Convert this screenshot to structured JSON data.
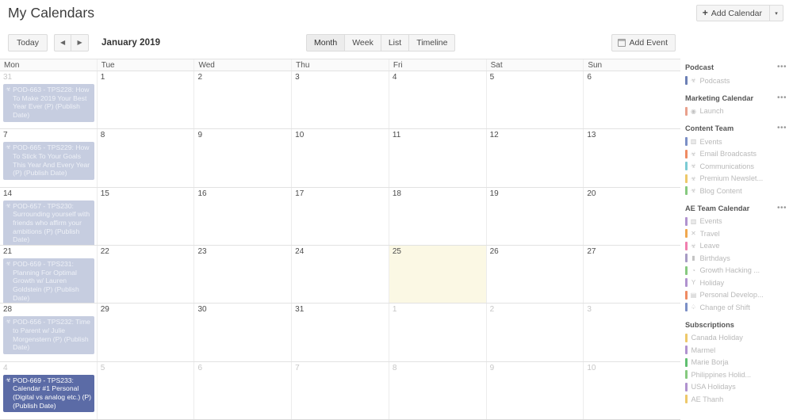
{
  "header": {
    "title": "My Calendars",
    "add_calendar_label": "Add Calendar",
    "add_calendar_icon": "plus-icon",
    "add_calendar_caret": "▾"
  },
  "toolbar": {
    "today_label": "Today",
    "prev_icon": "◀",
    "next_icon": "▶",
    "period_label": "January 2019",
    "views": [
      {
        "label": "Month",
        "active": true
      },
      {
        "label": "Week",
        "active": false
      },
      {
        "label": "List",
        "active": false
      },
      {
        "label": "Timeline",
        "active": false
      }
    ],
    "add_event_label": "Add Event",
    "add_event_icon": "calendar-icon"
  },
  "calendar": {
    "day_headers": [
      "Mon",
      "Tue",
      "Wed",
      "Thu",
      "Fri",
      "Sat",
      "Sun"
    ],
    "today_cell": {
      "week": 3,
      "day": 4,
      "date": "25",
      "highlight_color": "#fbf8e4"
    },
    "weeks": [
      {
        "days": [
          {
            "num": "31",
            "other_month": true,
            "events": [
              {
                "title": "POD-663 - TPS228: How To Make 2019 Your Best Year Ever (P) (Publish Date)",
                "glyph": "☣",
                "style": "muted"
              }
            ]
          },
          {
            "num": "1",
            "other_month": false,
            "events": []
          },
          {
            "num": "2",
            "other_month": false,
            "events": []
          },
          {
            "num": "3",
            "other_month": false,
            "events": []
          },
          {
            "num": "4",
            "other_month": false,
            "events": []
          },
          {
            "num": "5",
            "other_month": false,
            "events": []
          },
          {
            "num": "6",
            "other_month": false,
            "events": []
          }
        ]
      },
      {
        "days": [
          {
            "num": "7",
            "other_month": false,
            "events": [
              {
                "title": "POD-665 - TPS229: How To Stick To Your Goals This Year And Every Year (P) (Publish Date)",
                "glyph": "☣",
                "style": "muted"
              }
            ]
          },
          {
            "num": "8",
            "other_month": false,
            "events": []
          },
          {
            "num": "9",
            "other_month": false,
            "events": []
          },
          {
            "num": "10",
            "other_month": false,
            "events": []
          },
          {
            "num": "11",
            "other_month": false,
            "events": []
          },
          {
            "num": "12",
            "other_month": false,
            "events": []
          },
          {
            "num": "13",
            "other_month": false,
            "events": []
          }
        ]
      },
      {
        "days": [
          {
            "num": "14",
            "other_month": false,
            "events": [
              {
                "title": "POD-657 - TPS230: Surrounding yourself with friends who affirm your ambitions (P) (Publish Date)",
                "glyph": "☣",
                "style": "muted"
              }
            ]
          },
          {
            "num": "15",
            "other_month": false,
            "events": []
          },
          {
            "num": "16",
            "other_month": false,
            "events": []
          },
          {
            "num": "17",
            "other_month": false,
            "events": []
          },
          {
            "num": "18",
            "other_month": false,
            "events": []
          },
          {
            "num": "19",
            "other_month": false,
            "events": []
          },
          {
            "num": "20",
            "other_month": false,
            "events": []
          }
        ]
      },
      {
        "days": [
          {
            "num": "21",
            "other_month": false,
            "events": [
              {
                "title": "POD-659 - TPS231: Planning For Optimal Growth w/ Lauren Goldstein (P) (Publish Date)",
                "glyph": "☣",
                "style": "muted"
              }
            ]
          },
          {
            "num": "22",
            "other_month": false,
            "events": []
          },
          {
            "num": "23",
            "other_month": false,
            "events": []
          },
          {
            "num": "24",
            "other_month": false,
            "events": []
          },
          {
            "num": "25",
            "other_month": false,
            "today": true,
            "events": []
          },
          {
            "num": "26",
            "other_month": false,
            "events": []
          },
          {
            "num": "27",
            "other_month": false,
            "events": []
          }
        ]
      },
      {
        "days": [
          {
            "num": "28",
            "other_month": false,
            "events": [
              {
                "title": "POD-656 - TPS232: Time to Parent w/ Julie Morgenstern (P) (Publish Date)",
                "glyph": "☣",
                "style": "muted"
              }
            ]
          },
          {
            "num": "29",
            "other_month": false,
            "events": []
          },
          {
            "num": "30",
            "other_month": false,
            "events": []
          },
          {
            "num": "31",
            "other_month": false,
            "events": []
          },
          {
            "num": "1",
            "other_month": true,
            "events": []
          },
          {
            "num": "2",
            "other_month": true,
            "events": []
          },
          {
            "num": "3",
            "other_month": true,
            "events": []
          }
        ]
      },
      {
        "days": [
          {
            "num": "4",
            "other_month": true,
            "events": [
              {
                "title": "POD-669 - TPS233: Calendar #1 Personal (Digital vs analog etc.) (P) (Publish Date)",
                "glyph": "☣",
                "style": "selected"
              }
            ]
          },
          {
            "num": "5",
            "other_month": true,
            "events": []
          },
          {
            "num": "6",
            "other_month": true,
            "events": []
          },
          {
            "num": "7",
            "other_month": true,
            "events": []
          },
          {
            "num": "8",
            "other_month": true,
            "events": []
          },
          {
            "num": "9",
            "other_month": true,
            "events": []
          },
          {
            "num": "10",
            "other_month": true,
            "events": []
          }
        ]
      }
    ]
  },
  "sidebar": {
    "menu_icon": "•••",
    "groups": [
      {
        "title": "Podcast",
        "items": [
          {
            "label": "Podcasts",
            "color": "#6b7fb5",
            "glyph": "☣"
          }
        ]
      },
      {
        "title": "Marketing Calendar",
        "items": [
          {
            "label": "Launch",
            "color": "#e9a08c",
            "glyph": "◉"
          }
        ]
      },
      {
        "title": "Content Team",
        "items": [
          {
            "label": "Events",
            "color": "#7b8fc6",
            "glyph": "▥"
          },
          {
            "label": "Email Broadcasts",
            "color": "#ef8b63",
            "glyph": "☣"
          },
          {
            "label": "Communications",
            "color": "#7ccbd4",
            "glyph": "☣"
          },
          {
            "label": "Premium Newslet...",
            "color": "#edc86a",
            "glyph": "☣"
          },
          {
            "label": "Blog Content",
            "color": "#86c97f",
            "glyph": "☣"
          }
        ]
      },
      {
        "title": "AE Team Calendar",
        "items": [
          {
            "label": "Events",
            "color": "#b092cf",
            "glyph": "▥"
          },
          {
            "label": "Travel",
            "color": "#f0a84e",
            "glyph": "✕"
          },
          {
            "label": "Leave",
            "color": "#f07fae",
            "glyph": "☣"
          },
          {
            "label": "Birthdays",
            "color": "#a79bc4",
            "glyph": "▮"
          },
          {
            "label": "Growth Hacking ...",
            "color": "#86c97f",
            "glyph": "◔"
          },
          {
            "label": "Holiday",
            "color": "#b092cf",
            "glyph": "Y"
          },
          {
            "label": "Personal Develop...",
            "color": "#ef8b63",
            "glyph": "▤"
          },
          {
            "label": "Change of Shift",
            "color": "#7b8fc6",
            "glyph": "♤"
          }
        ]
      },
      {
        "title": "Subscriptions",
        "items": [
          {
            "label": "Canada Holiday",
            "color": "#edc86a",
            "glyph": ""
          },
          {
            "label": "Marmel",
            "color": "#b092cf",
            "glyph": ""
          },
          {
            "label": "Marie Borja",
            "color": "#5fbf70",
            "glyph": ""
          },
          {
            "label": "Philippines Holid...",
            "color": "#86c97f",
            "glyph": ""
          },
          {
            "label": "USA Holidays",
            "color": "#b092cf",
            "glyph": ""
          },
          {
            "label": "AE Thanh",
            "color": "#edc86a",
            "glyph": ""
          }
        ]
      }
    ]
  }
}
